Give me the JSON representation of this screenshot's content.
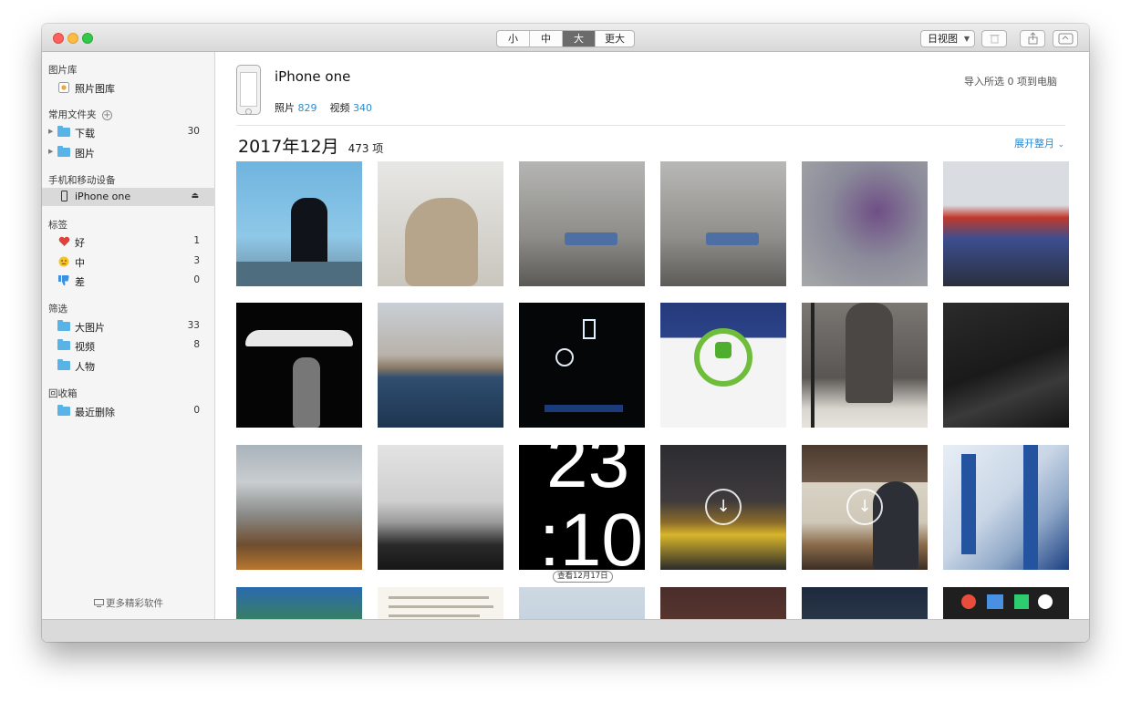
{
  "toolbar": {
    "sizes": [
      "小",
      "中",
      "大",
      "更大"
    ],
    "active_size": "大",
    "view_select": "日视图"
  },
  "sidebar": {
    "library_section": "图片库",
    "library_item": "照片图库",
    "favorites_section": "常用文件夹",
    "favorites": [
      {
        "label": "下载",
        "count": "30"
      },
      {
        "label": "图片",
        "count": ""
      }
    ],
    "devices_section": "手机和移动设备",
    "device_item": "iPhone one",
    "tags_section": "标签",
    "tags": [
      {
        "label": "好",
        "count": "1",
        "icon": "heart-icon",
        "color": "#e0413a"
      },
      {
        "label": "中",
        "count": "3",
        "icon": "neutral-face-icon",
        "color": "#f5c227"
      },
      {
        "label": "差",
        "count": "0",
        "icon": "thumbs-down-icon",
        "color": "#3f8fe0"
      }
    ],
    "filter_section": "筛选",
    "filters": [
      {
        "label": "大图片",
        "count": "33"
      },
      {
        "label": "视频",
        "count": "8"
      },
      {
        "label": "人物",
        "count": ""
      }
    ],
    "trash_section": "回收箱",
    "trash_item": {
      "label": "最近删除",
      "count": "0"
    },
    "footer": "更多精彩软件"
  },
  "device": {
    "name": "iPhone one",
    "photos_label": "照片",
    "photos_count": "829",
    "videos_label": "视频",
    "videos_count": "340",
    "import_text": "导入所选 0 项到电脑"
  },
  "month_header": {
    "title": "2017年12月",
    "count": "473 项",
    "expand_label": "展开整月"
  },
  "clock_digits": {
    "line1": "23",
    "line2": ":10"
  },
  "date_pill": "查看12月17日",
  "colors": {
    "accent": "#2a8dd4",
    "folder": "#5ab3e7",
    "status_bar": "#dadada"
  }
}
